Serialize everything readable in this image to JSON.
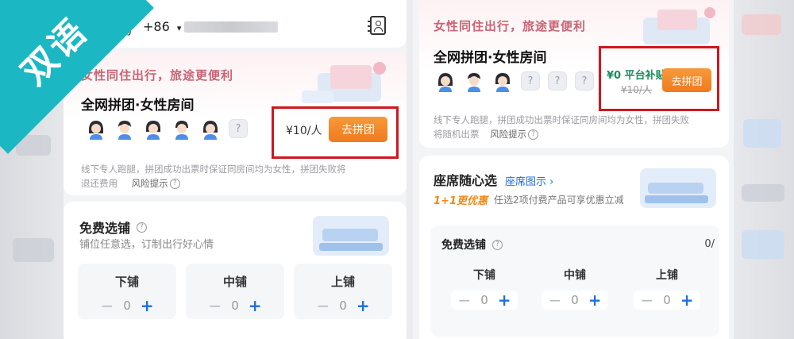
{
  "watermark": {
    "text": "双语"
  },
  "left": {
    "phone": {
      "label": "号码",
      "code": "+86",
      "caret": "▾"
    },
    "promo": {
      "tag": "女性同住出行，旅途更便利",
      "title": "全网拼团·女性房间",
      "question": "?",
      "price": "¥10/人",
      "button": "去拼团",
      "note_line1": "线下专人跑腿，拼团成功出票时保证同房间均为女性，拼团失败将",
      "note_line2": "退还费用",
      "risk": "风险提示"
    },
    "free": {
      "title": "免费选铺",
      "subtitle": "铺位任意选，订制出行好心情",
      "berths": [
        {
          "label": "下铺",
          "minus": "−",
          "value": "0",
          "plus": "+"
        },
        {
          "label": "中铺",
          "minus": "−",
          "value": "0",
          "plus": "+"
        },
        {
          "label": "上铺",
          "minus": "−",
          "value": "0",
          "plus": "+"
        }
      ]
    }
  },
  "right": {
    "promo": {
      "tag": "女性同住出行，旅途更便利",
      "title": "全网拼团·女性房间",
      "questions": [
        "?",
        "?",
        "?"
      ],
      "subsidy": "¥0 平台补贴",
      "old_price": "¥10/人",
      "button": "去拼团",
      "note_line1": "线下专人跑腿，拼团成功出票时保证同房间均为女性，拼团失败",
      "note_line2": "将随机出票",
      "risk": "风险提示"
    },
    "seat": {
      "title": "座席随心选",
      "link": "座席图示 ›",
      "offer": "1+1更优惠",
      "offer_desc": "任选2项付费产品可享优惠立减"
    },
    "free": {
      "title": "免费选铺",
      "count": "0/",
      "berths": [
        {
          "label": "下铺",
          "minus": "−",
          "value": "0",
          "plus": "+"
        },
        {
          "label": "中铺",
          "minus": "−",
          "value": "0",
          "plus": "+"
        },
        {
          "label": "上铺",
          "minus": "−",
          "value": "0",
          "plus": "+"
        }
      ]
    }
  },
  "colors": {
    "accent_orange": "#ef7a1f",
    "highlight_red": "#d0161e",
    "subsidy_green": "#1e8a5e",
    "offer_orange": "#f08a1b",
    "link_blue": "#1b6fe0",
    "watermark_teal": "#1bb8c4"
  }
}
